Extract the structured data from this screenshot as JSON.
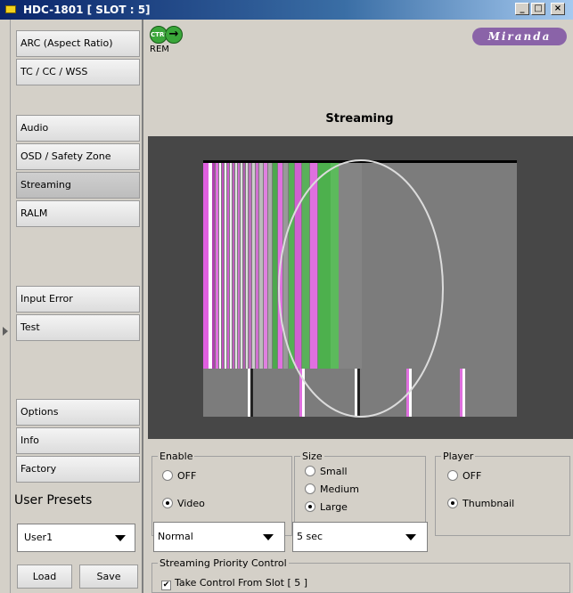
{
  "window": {
    "title": "HDC-1801 [ SLOT : 5]"
  },
  "sidebar": {
    "items": [
      {
        "label": "ARC (Aspect Ratio)"
      },
      {
        "label": "TC / CC / WSS"
      },
      {
        "label": "Audio"
      },
      {
        "label": "OSD / Safety Zone"
      },
      {
        "label": "Streaming",
        "active": true
      },
      {
        "label": "RALM"
      },
      {
        "label": "Input Error"
      },
      {
        "label": "Test"
      },
      {
        "label": "Options"
      },
      {
        "label": "Info"
      },
      {
        "label": "Factory"
      }
    ],
    "presets_label": "User Presets",
    "preset_select": "User1",
    "load_label": "Load",
    "save_label": "Save"
  },
  "header": {
    "ctrl_badge": "CTRL",
    "ctrl_arrow": "→",
    "rem_label": "REM",
    "logo": "Miranda",
    "section_title": "Streaming"
  },
  "enable": {
    "legend": "Enable",
    "options": [
      "OFF",
      "Video"
    ],
    "selected": "Video"
  },
  "size": {
    "legend": "Size",
    "options": [
      "Small",
      "Medium",
      "Large"
    ],
    "selected": "Large"
  },
  "player": {
    "legend": "Player",
    "options": [
      "OFF",
      "Thumbnail"
    ],
    "selected": "Thumbnail"
  },
  "quality_select": "Normal",
  "interval_select": "5 sec",
  "priority": {
    "legend": "Streaming Priority Control",
    "checkbox_label": "Take Control From Slot [ 5 ]",
    "checked": true,
    "check_mark": "✔"
  },
  "colors": {
    "accent": "#0a246a",
    "logo": "#8a63a8",
    "preview_bg": "#474747"
  }
}
